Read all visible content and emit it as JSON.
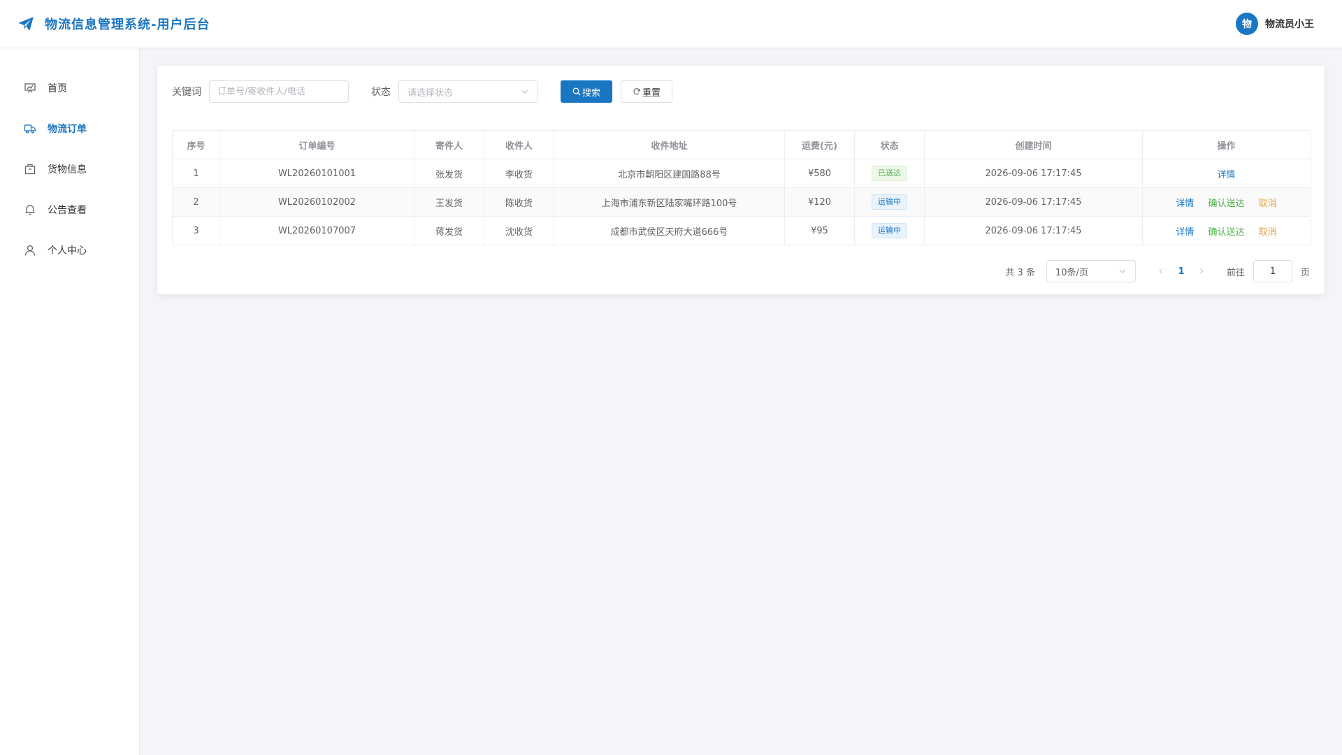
{
  "header": {
    "title": "物流信息管理系统-用户后台",
    "user_avatar_text": "物",
    "user_name": "物流员小王"
  },
  "sidebar": {
    "items": [
      {
        "label": "首页",
        "icon": "dashboard-icon"
      },
      {
        "label": "物流订单",
        "icon": "truck-icon",
        "active": true
      },
      {
        "label": "货物信息",
        "icon": "package-icon"
      },
      {
        "label": "公告查看",
        "icon": "bell-icon"
      },
      {
        "label": "个人中心",
        "icon": "user-icon"
      }
    ]
  },
  "filters": {
    "keyword_label": "关键词",
    "keyword_placeholder": "订单号/寄收件人/电话",
    "keyword_value": "",
    "status_label": "状态",
    "status_placeholder": "请选择状态",
    "search_label": "搜索",
    "reset_label": "重置"
  },
  "table": {
    "columns": [
      "序号",
      "订单编号",
      "寄件人",
      "收件人",
      "收件地址",
      "运费(元)",
      "状态",
      "创建时间",
      "操作"
    ],
    "rows": [
      {
        "index": "1",
        "order_no": "WL20260101001",
        "sender": "张发货",
        "receiver": "李收货",
        "address": "北京市朝阳区建国路88号",
        "fee": "¥580",
        "status": "已送达",
        "status_type": "success",
        "created": "2026-09-06 17:17:45",
        "actions": [
          "详情"
        ]
      },
      {
        "index": "2",
        "order_no": "WL20260102002",
        "sender": "王发货",
        "receiver": "陈收货",
        "address": "上海市浦东新区陆家嘴环路100号",
        "fee": "¥120",
        "status": "运输中",
        "status_type": "info",
        "created": "2026-09-06 17:17:45",
        "actions": [
          "详情",
          "确认送达",
          "取消"
        ]
      },
      {
        "index": "3",
        "order_no": "WL20260107007",
        "sender": "蒋发货",
        "receiver": "沈收货",
        "address": "成都市武侯区天府大道666号",
        "fee": "¥95",
        "status": "运输中",
        "status_type": "info",
        "created": "2026-09-06 17:17:45",
        "actions": [
          "详情",
          "确认送达",
          "取消"
        ]
      }
    ]
  },
  "pagination": {
    "total_text": "共 3 条",
    "page_size": "10条/页",
    "current_page": "1",
    "goto_label": "前往",
    "goto_value": "1",
    "page_suffix": "页"
  },
  "colors": {
    "primary": "#1976c2",
    "success": "#52b04a",
    "warning": "#e6a23c"
  }
}
